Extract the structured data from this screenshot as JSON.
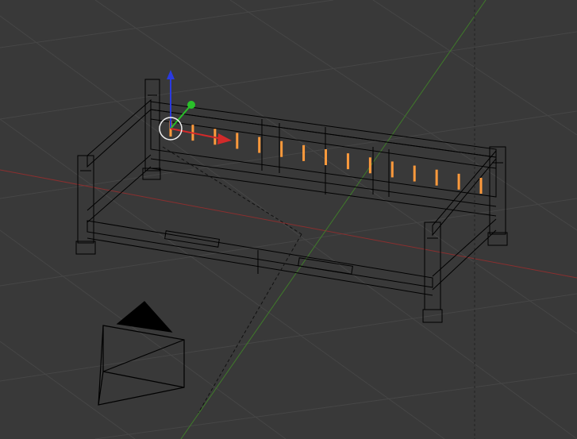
{
  "app": "Blender",
  "view": {
    "shading": "wireframe",
    "background_color": "#393939",
    "grid_color": "#444444",
    "x_axis_color": "#8a2f2f",
    "y_axis_color": "#3f7a2a",
    "wire_color": "#000000",
    "selected_color": "#ff9a3c"
  },
  "scene": {
    "objects": [
      {
        "name": "bed-frame",
        "selected": false
      },
      {
        "name": "camera",
        "selected": false
      }
    ],
    "selection": {
      "name": "rail-slats",
      "count": 15,
      "state": "selected"
    }
  },
  "gizmo": {
    "type": "translate",
    "axes": [
      {
        "axis": "x",
        "color": "#d22a2a"
      },
      {
        "axis": "y",
        "color": "#2ac02a"
      },
      {
        "axis": "z",
        "color": "#2a3ae0"
      }
    ]
  }
}
